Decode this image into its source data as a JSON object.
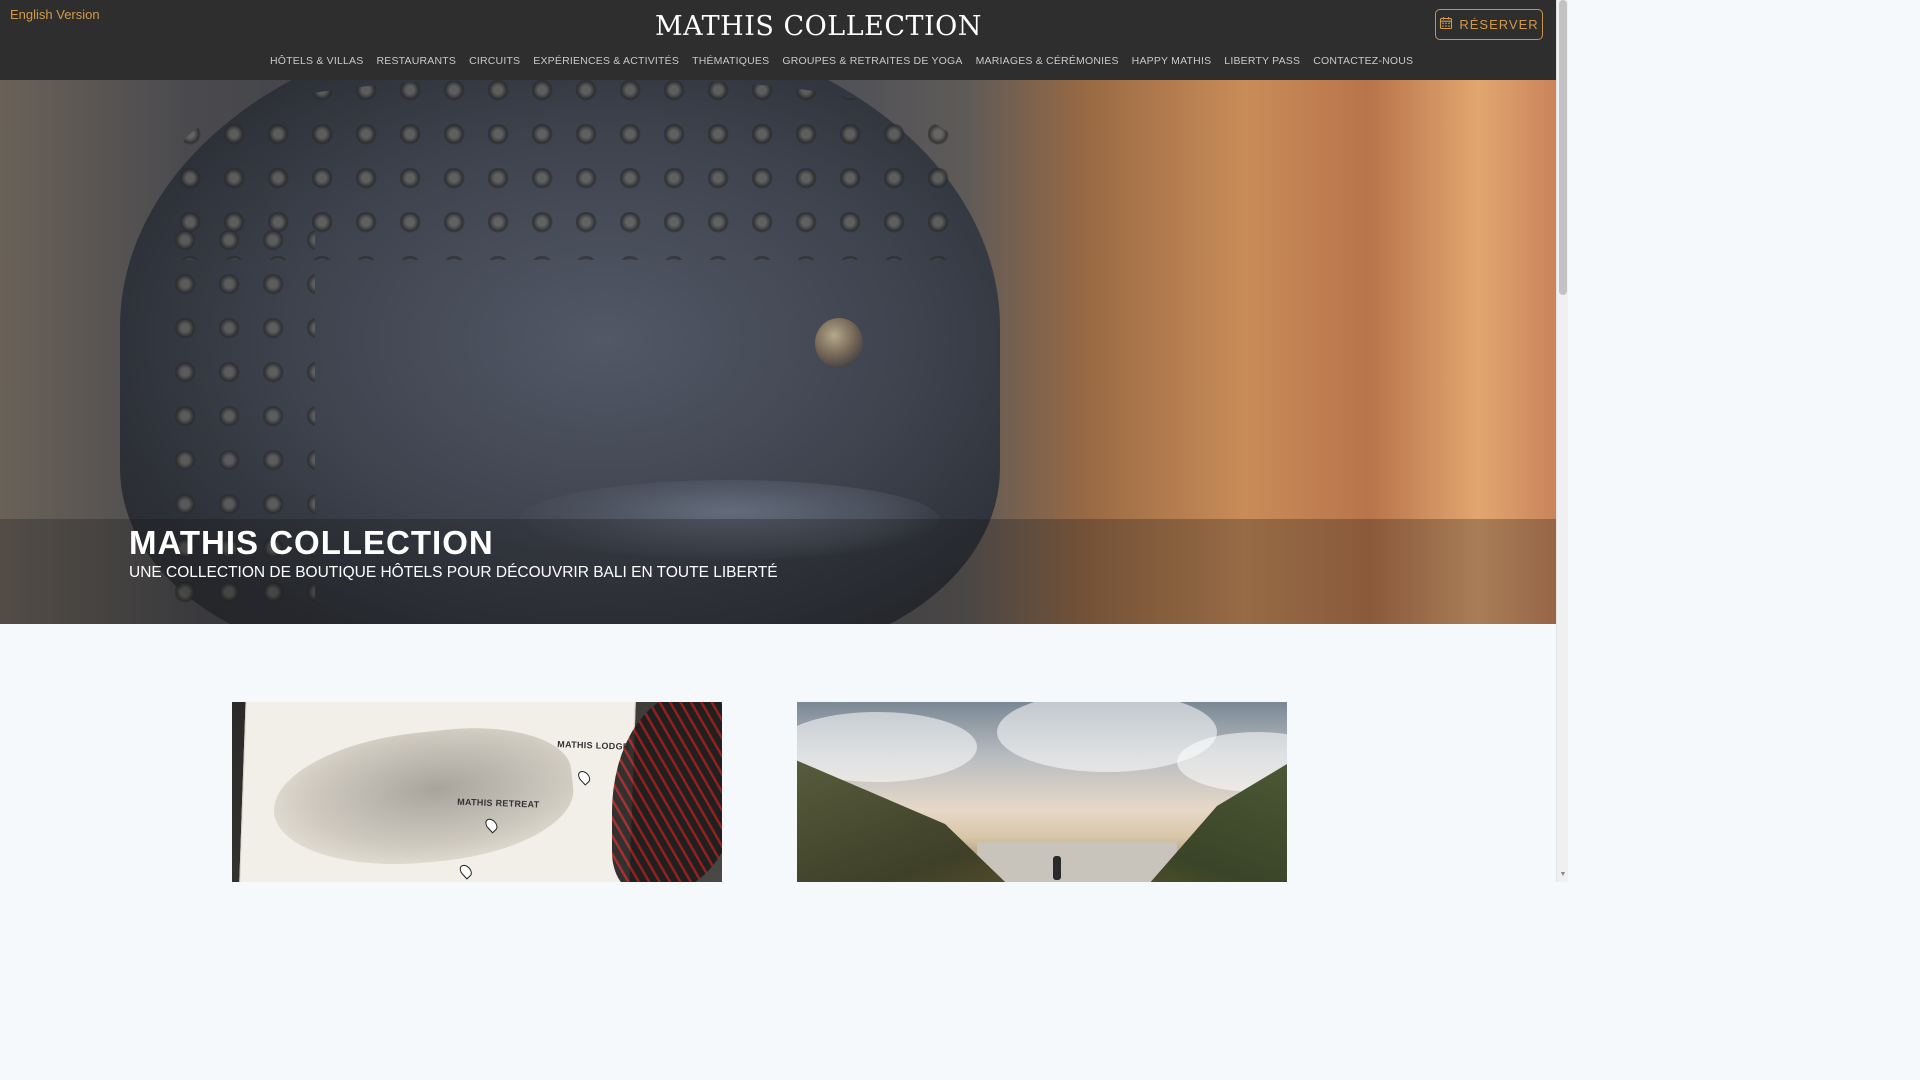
{
  "header": {
    "language_link": "English Version",
    "logo_text": "MATHIS COLLECTION",
    "reserve_label": "RÉSERVER",
    "nav_items": [
      "HÔTELS & VILLAS",
      "RESTAURANTS",
      "CIRCUITS",
      "EXPÉRIENCES & ACTIVITÉS",
      "THÉMATIQUES",
      "GROUPES & RETRAITES DE YOGA",
      "MARIAGES & CÉRÉMONIES",
      "HAPPY MATHIS",
      "LIBERTY PASS",
      "CONTACTEZ-NOUS"
    ]
  },
  "hero": {
    "title": "MATHIS COLLECTION",
    "subtitle": "UNE COLLECTION DE BOUTIQUE HÔTELS POUR DÉCOUVRIR BALI EN TOUTE LIBERTÉ"
  },
  "cards": {
    "map_labels": {
      "lodge": "MATHIS LODGE",
      "retreat": "MATHIS RETREAT"
    }
  },
  "colors": {
    "header_bg": "#2e2e2e",
    "accent_gold": "#d19a4a",
    "page_bg": "#f6f9fc"
  },
  "icons": {
    "reserve": "calendar-icon"
  }
}
